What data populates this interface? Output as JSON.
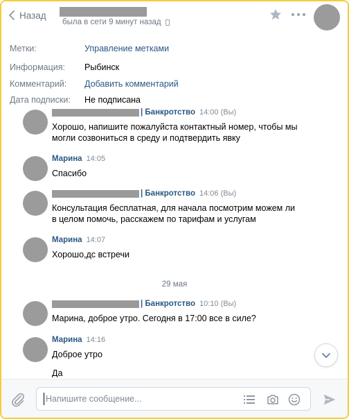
{
  "header": {
    "back_label": "Назад",
    "last_seen": "была в сети 9 минут назад"
  },
  "info": {
    "rows": [
      {
        "key": "Метки:",
        "value": "Управление метками"
      },
      {
        "key": "Информация:",
        "value": "Рыбинск"
      },
      {
        "key": "Комментарий:",
        "value": "Добавить комментарий"
      },
      {
        "key": "Дата подписки:",
        "value": "Не подписана"
      }
    ]
  },
  "messages": [
    {
      "author": "| Банкротство",
      "time": "14:00 (Вы)",
      "text": "Хорошо, напишите пожалуйста контактный номер, чтобы мы могли созвониться в среду и подтвердить явку"
    },
    {
      "author": "Марина",
      "time": "14:05",
      "text": "Спасибо"
    },
    {
      "author": "| Банкротство",
      "time": "14:06 (Вы)",
      "text": "Консультация бесплатная, для начала посмотрим можем ли в целом помочь, расскажем по тарифам и услугам"
    },
    {
      "author": "Марина",
      "time": "14:07",
      "text": "Хорошо,дс встречи"
    },
    {
      "author": "| Банкротство",
      "time": "10:10 (Вы)",
      "text": "Марина, доброе утро. Сегодня в 17:00 все в силе?"
    },
    {
      "author": "Марина",
      "time": "14:16",
      "text": "Доброе утро",
      "text2": "Да"
    }
  ],
  "date_separator": "29 мая",
  "composer": {
    "placeholder": "Напишите сообщение..."
  },
  "colors": {
    "link": "#2a5885",
    "muted": "#6f7985",
    "frame": "#f5cd3a",
    "redaction": "#9a9a9a"
  }
}
